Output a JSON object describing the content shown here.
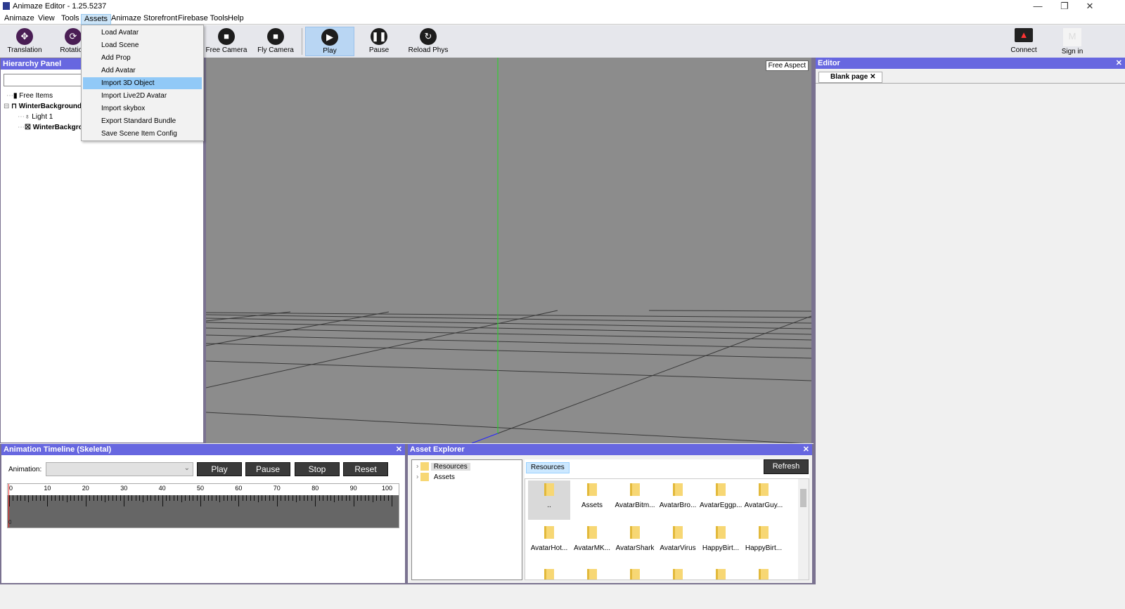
{
  "window": {
    "title": "Animaze Editor - 1.25.5237",
    "minimize": "—",
    "restore": "❐",
    "close": "✕"
  },
  "menubar": [
    "Animaze",
    "View",
    "Tools",
    "Assets",
    "Animaze Storefront",
    "Firebase Tools",
    "Help"
  ],
  "assets_menu": {
    "items": [
      "Load Avatar",
      "Load Scene",
      "Add Prop",
      "Add Avatar",
      "Import 3D Object",
      "Import Live2D Avatar",
      "Import skybox",
      "Export Standard Bundle",
      "Save Scene Item Config"
    ],
    "highlighted": "Import 3D Object"
  },
  "toolbar": {
    "left": [
      {
        "label": "Translation",
        "icon": "move-icon"
      },
      {
        "label": "Rotation",
        "icon": "rotate-icon"
      },
      {
        "label": "Free Camera",
        "icon": "camera-icon"
      },
      {
        "label": "Fly Camera",
        "icon": "camera-icon"
      },
      {
        "label": "Play",
        "icon": "play-icon",
        "selected": true
      },
      {
        "label": "Pause",
        "icon": "pause-icon"
      },
      {
        "label": "Reload Phys",
        "icon": "reload-icon"
      }
    ],
    "right": [
      {
        "label": "Connect",
        "icon": "devices-icon"
      },
      {
        "label": "Sign in",
        "icon": "user-icon"
      }
    ]
  },
  "hierarchy": {
    "title": "Hierarchy Panel",
    "search": "",
    "items": [
      {
        "label": "Free Items",
        "bold": false
      },
      {
        "label": "WinterBackground",
        "bold": true
      },
      {
        "label": "Light 1",
        "bold": false
      },
      {
        "label": "WinterBackground",
        "bold": true
      }
    ]
  },
  "viewport": {
    "aspect": "Free Aspect"
  },
  "editor": {
    "title": "Editor",
    "close": "✕",
    "tab": "Blank page",
    "tab_close": "✕"
  },
  "timeline": {
    "title": "Animation Timeline (Skeletal)",
    "close": "✕",
    "animation_label": "Animation:",
    "animation_value": "",
    "buttons": [
      "Play",
      "Pause",
      "Stop",
      "Reset"
    ],
    "ticks": [
      "0",
      "10",
      "20",
      "30",
      "40",
      "50",
      "60",
      "70",
      "80",
      "90",
      "100"
    ],
    "cursor": "0"
  },
  "asset_explorer": {
    "title": "Asset Explorer",
    "close": "✕",
    "tree": [
      "Resources",
      "Assets"
    ],
    "breadcrumb": "Resources",
    "refresh": "Refresh",
    "items": [
      "..",
      "Assets",
      "AvatarBitm...",
      "AvatarBro...",
      "AvatarEggp...",
      "AvatarGuy...",
      "AvatarHot...",
      "AvatarMK...",
      "AvatarShark",
      "AvatarVirus",
      "HappyBirt...",
      "HappyBirt...",
      "",
      "",
      "",
      "",
      "",
      ""
    ]
  },
  "colors": {
    "panel_header": "#6767e0",
    "highlight": "#91c9f7",
    "frame": "#7a7290",
    "viewport": "#8c8c8c",
    "y_axis": "#22dd22",
    "z_axis": "#2222ff"
  }
}
